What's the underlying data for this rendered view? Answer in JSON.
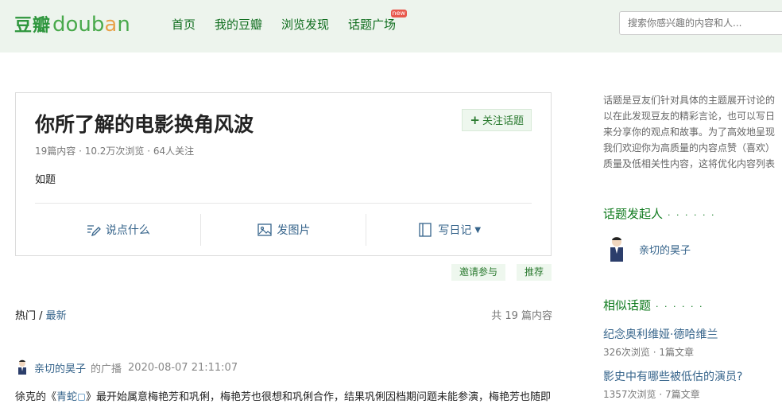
{
  "header": {
    "logo_cn": "豆瓣",
    "logo_en_1": "doub",
    "logo_en_2": "a",
    "logo_en_3": "n",
    "nav": [
      "首页",
      "我的豆瓣",
      "浏览发现",
      "话题广场"
    ],
    "new_badge": "new",
    "search_placeholder": "搜索你感兴趣的内容和人..."
  },
  "topic": {
    "title": "你所了解的电影换角风波",
    "follow_label": "关注话题",
    "meta": "19篇内容 · 10.2万次浏览 · 64人关注",
    "description": "如题",
    "actions": [
      "说点什么",
      "发图片",
      "写日记"
    ]
  },
  "pills": {
    "invite": "邀请参与",
    "recommend": "推荐"
  },
  "tabs": {
    "hot": "热门",
    "sep": " / ",
    "latest": "最新",
    "count": "共 19 篇内容"
  },
  "post": {
    "author": "亲切的昊子",
    "action": "的广播",
    "time": "2020-08-07 21:11:07",
    "body_1": "徐克的《",
    "body_link": "青蛇",
    "body_2": "》最开始属意梅艳芳和巩俐，梅艳芳也很想和巩俐合作，结果巩俐因档期问题未能参演，梅艳芳也随即"
  },
  "sidebar": {
    "intro_lines": [
      "话题是豆友们针对具体的主题展开讨论的",
      "以在此发现豆友的精彩言论，也可以写日",
      "来分享你的观点和故事。为了高效地呈现",
      "我们欢迎你为高质量的内容点赞（喜欢）",
      "质量及低相关性内容，这将优化内容列表"
    ],
    "initiator_heading": "话题发起人",
    "initiator_name": "亲切的昊子",
    "similar_heading": "相似话题",
    "dots": "· · · · · ·",
    "similar": [
      {
        "title": "纪念奥利维娅·德哈维兰",
        "meta": "326次浏览 · 1篇文章"
      },
      {
        "title": "影史中有哪些被低估的演员?",
        "meta": "1357次浏览 · 7篇文章"
      }
    ]
  },
  "colors": {
    "brand_green": "#2e963d",
    "link_blue": "#36648b",
    "header_bg": "#edf4ed"
  }
}
